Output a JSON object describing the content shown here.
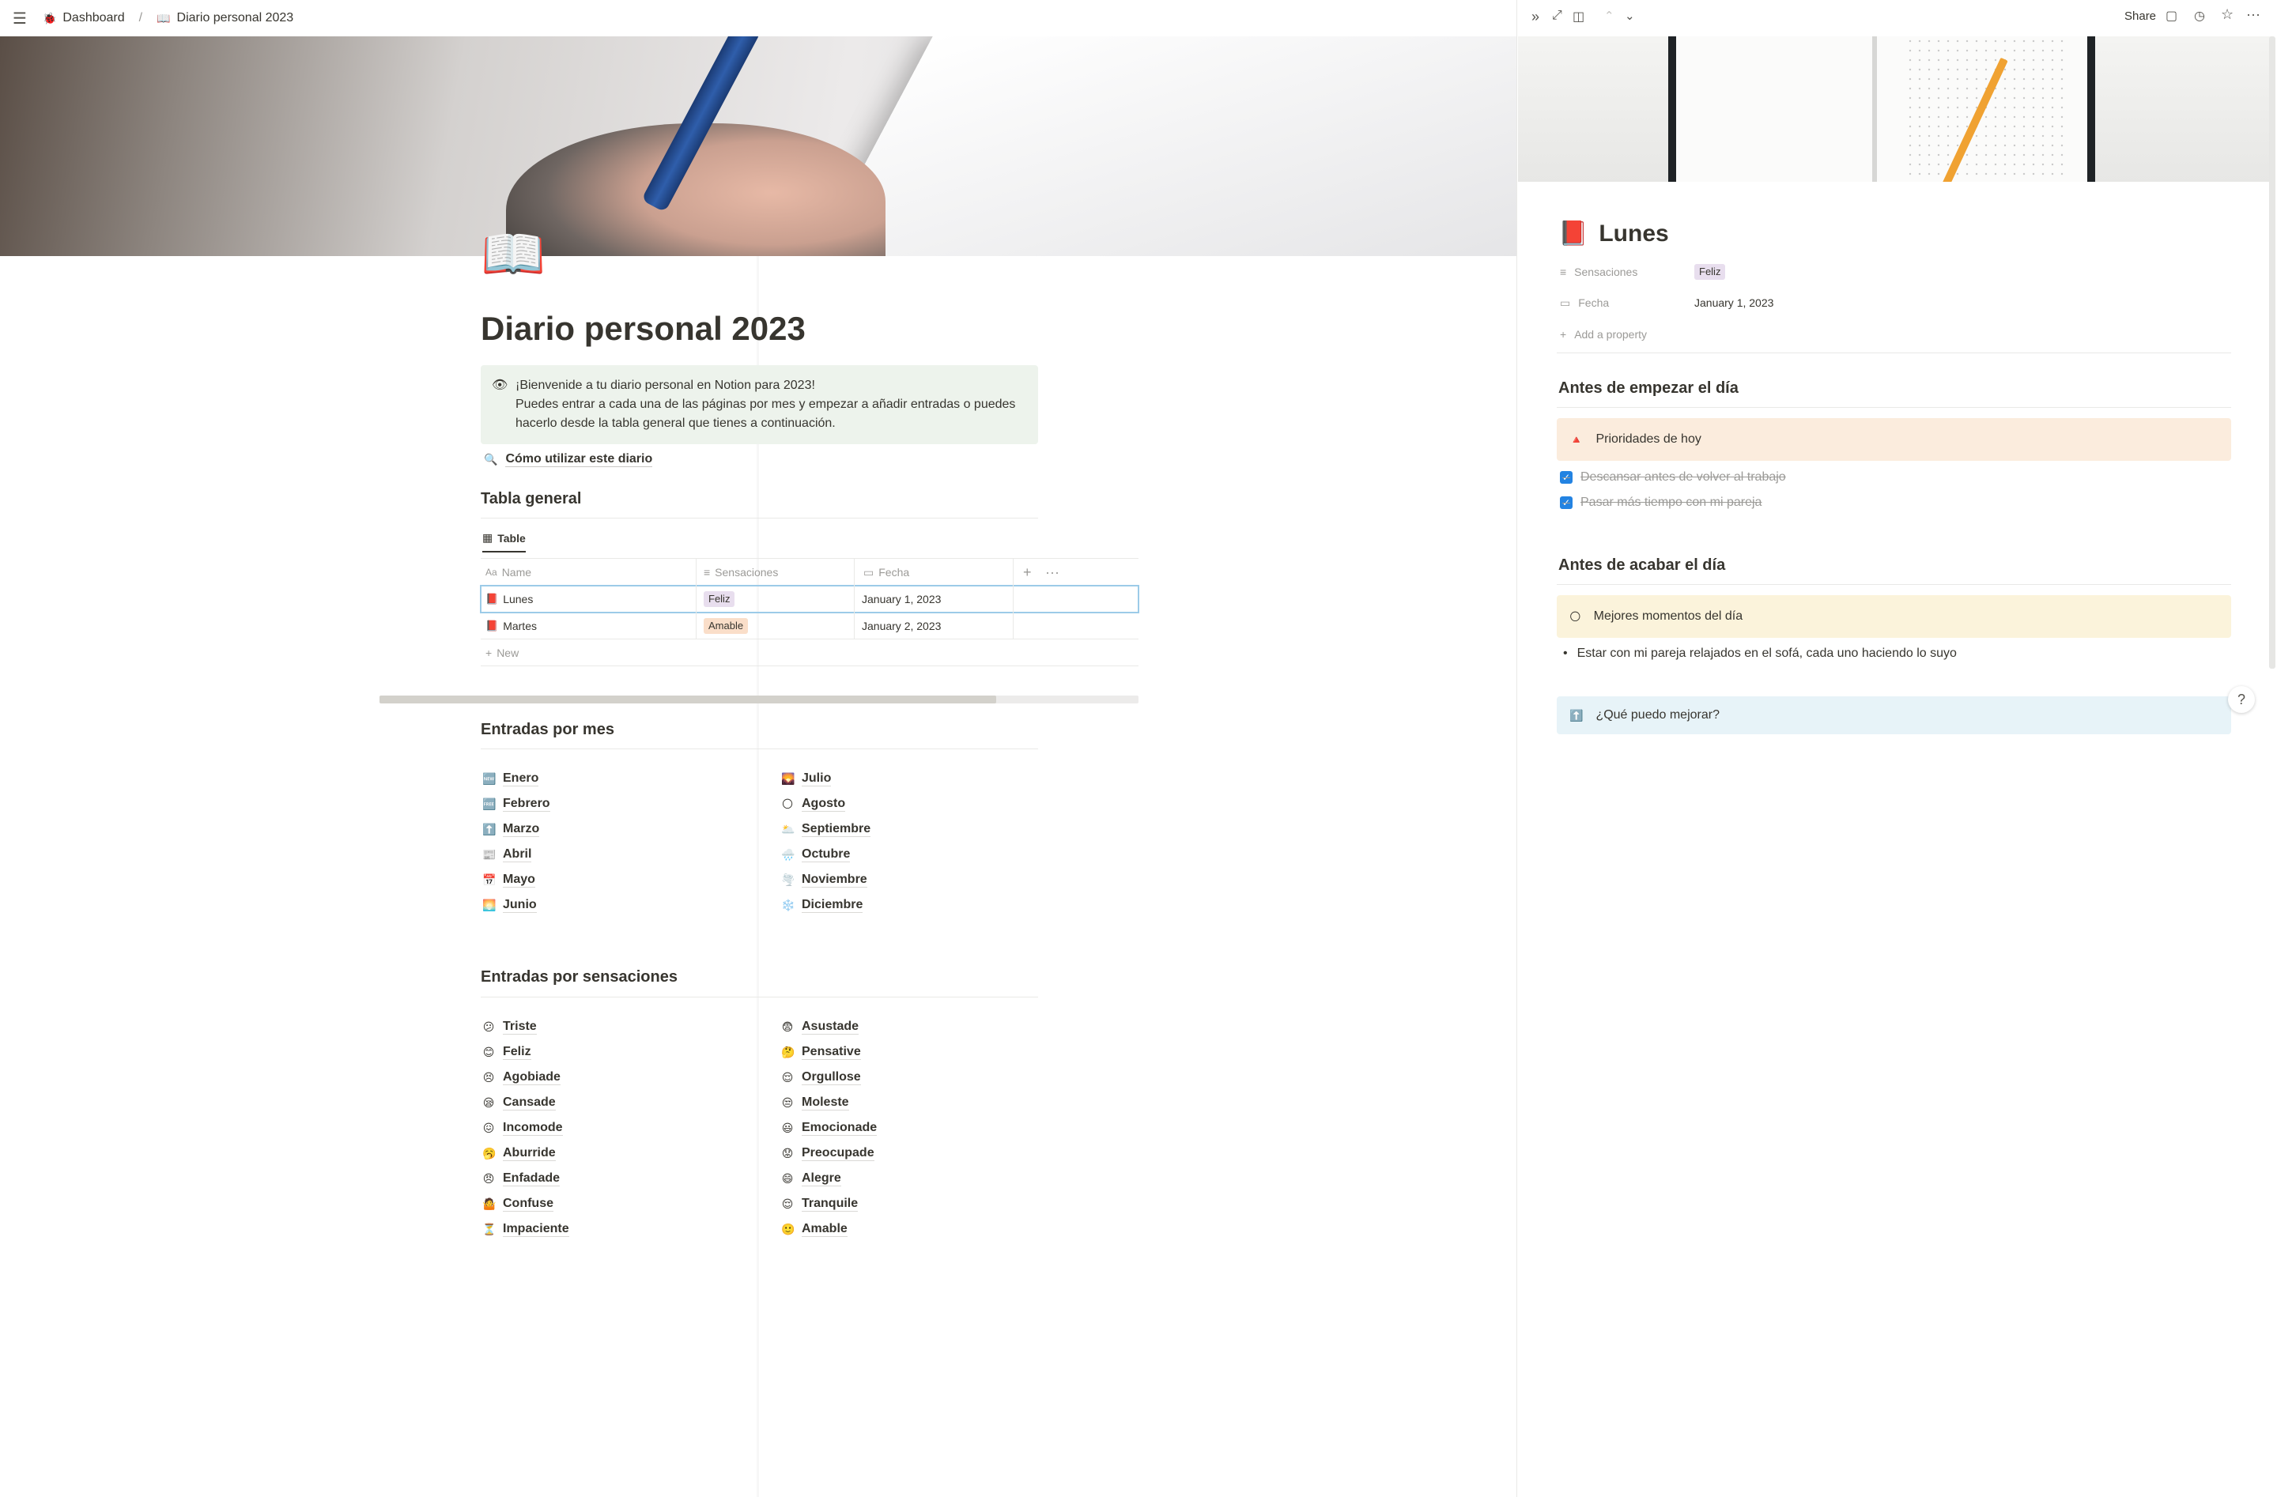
{
  "breadcrumb": {
    "workspace": "Dashboard",
    "workspace_icon": "🐞",
    "separator": "/",
    "page": "Diario personal 2023",
    "page_icon": "📖"
  },
  "page": {
    "icon": "📖",
    "title": "Diario personal 2023",
    "callout": {
      "icon": "👁",
      "line1": "¡Bienvenide a tu diario personal en Notion para 2023!",
      "line2": "Puedes entrar a cada una de las páginas por mes y empezar a añadir entradas o puedes hacerlo desde la tabla general que tienes a continuación."
    },
    "guide_link": {
      "icon": "🔍",
      "label": "Cómo utilizar este diario"
    }
  },
  "table_section": {
    "heading": "Tabla general",
    "view_tab": "Table",
    "columns": {
      "name": "Name",
      "sensaciones": "Sensaciones",
      "fecha": "Fecha"
    },
    "rows": [
      {
        "icon": "📕",
        "name": "Lunes",
        "sensacion": "Feliz",
        "fecha": "January 1, 2023"
      },
      {
        "icon": "📕",
        "name": "Martes",
        "sensacion": "Amable",
        "fecha": "January 2, 2023"
      }
    ],
    "new_label": "New",
    "tag_colors": {
      "Feliz": "#e8deee",
      "Amable": "#fadec9"
    }
  },
  "months_section": {
    "heading": "Entradas por mes",
    "left": [
      {
        "icon": "🆕",
        "label": "Enero"
      },
      {
        "icon": "🆓",
        "label": "Febrero"
      },
      {
        "icon": "⬆️",
        "label": "Marzo"
      },
      {
        "icon": "📰",
        "label": "Abril"
      },
      {
        "icon": "📅",
        "label": "Mayo"
      },
      {
        "icon": "🌅",
        "label": "Junio"
      }
    ],
    "right": [
      {
        "icon": "🌄",
        "label": "Julio"
      },
      {
        "icon": "🌕",
        "label": "Agosto"
      },
      {
        "icon": "🌥️",
        "label": "Septiembre"
      },
      {
        "icon": "🌧️",
        "label": "Octubre"
      },
      {
        "icon": "🌪️",
        "label": "Noviembre"
      },
      {
        "icon": "❄️",
        "label": "Diciembre"
      }
    ]
  },
  "feelings_section": {
    "heading": "Entradas por sensaciones",
    "left": [
      {
        "icon": "😕",
        "label": "Triste"
      },
      {
        "icon": "😊",
        "label": "Feliz"
      },
      {
        "icon": "😣",
        "label": "Agobiade"
      },
      {
        "icon": "😪",
        "label": "Cansade"
      },
      {
        "icon": "😖",
        "label": "Incomode"
      },
      {
        "icon": "🥱",
        "label": "Aburride"
      },
      {
        "icon": "😠",
        "label": "Enfadade"
      },
      {
        "icon": "🤷",
        "label": "Confuse"
      },
      {
        "icon": "⏳",
        "label": "Impaciente"
      }
    ],
    "right": [
      {
        "icon": "😨",
        "label": "Asustade"
      },
      {
        "icon": "🤔",
        "label": "Pensative"
      },
      {
        "icon": "😌",
        "label": "Orgullose"
      },
      {
        "icon": "😒",
        "label": "Moleste"
      },
      {
        "icon": "😃",
        "label": "Emocionade"
      },
      {
        "icon": "😟",
        "label": "Preocupade"
      },
      {
        "icon": "😄",
        "label": "Alegre"
      },
      {
        "icon": "😌",
        "label": "Tranquile"
      },
      {
        "icon": "🙂",
        "label": "Amable"
      }
    ]
  },
  "side_panel": {
    "toolbar": {
      "share": "Share"
    },
    "title_icon": "📕",
    "title": "Lunes",
    "properties": [
      {
        "icon": "≡",
        "label": "Sensaciones",
        "value": "Feliz"
      },
      {
        "icon": "▭",
        "label": "Fecha",
        "value": "January 1, 2023"
      }
    ],
    "add_property": "Add a property",
    "before_day": {
      "heading": "Antes de empezar el día",
      "callout_icon": "🔺",
      "callout_text": "Prioridades de hoy",
      "todos": [
        "Descansar antes de volver al trabajo",
        "Pasar más tiempo con mi pareja"
      ]
    },
    "end_day": {
      "heading": "Antes de acabar el día",
      "callout_icon": "🌕",
      "callout_text": "Mejores momentos del día",
      "bullets": [
        "Estar con mi pareja relajados en el sofá, cada uno haciendo lo suyo"
      ],
      "improve_icon": "⬆️",
      "improve_text": "¿Qué puedo mejorar?"
    },
    "callout_colors": {
      "priorities": "#fbecdd",
      "best": "#fbf3db",
      "improve": "#e7f3f8"
    }
  },
  "help_label": "?"
}
